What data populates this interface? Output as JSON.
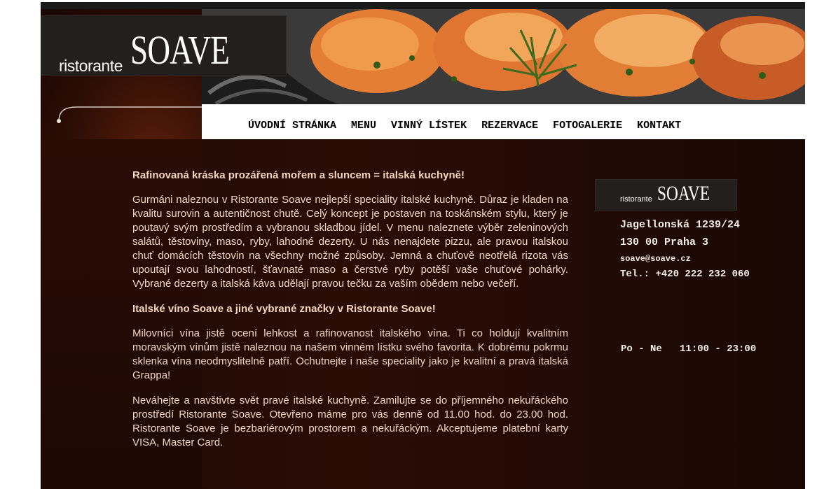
{
  "logo": {
    "small": "ristorante",
    "big": "SOAVE"
  },
  "nav": {
    "items": [
      "ÚVODNÍ STRÁNKA",
      "MENU",
      "VINNÝ LÍSTEK",
      "REZERVACE",
      "FOTOGALERIE",
      "KONTAKT"
    ]
  },
  "content": {
    "heading1": "Rafinovaná kráska prozářená mořem a sluncem = italská kuchyně!",
    "para1": "Gurmáni naleznou v Ristorante Soave nejlepší speciality italské kuchyně. Důraz je kladen na kvalitu surovin a autentičnost chutě. Celý koncept je postaven na toskánském stylu, který je poutavý svým prostředím a vybranou skladbou jídel. V menu naleznete výběr zeleninových salátů, těstoviny, maso, ryby, lahodné dezerty. U nás nenajdete pizzu, ale pravou italskou chuť domácích těstovin na všechny možné způsoby. Jemná a chuťově neotřelá rizota vás upoutají svou lahodností, šťavnaté maso a čerstvé ryby potěší vaše chuťové pohárky. Vybrané dezerty a italská káva udělají pravou tečku za vaším obědem nebo večeří.",
    "heading2": "Italské víno Soave a jiné vybrané značky v Ristorante Soave!",
    "para2": "Milovníci vína jistě ocení lehkost a rafinovanost italského vína. Ti co holdují kvalitním moravským vínům jistě naleznou na našem vinném lístku svého favorita. K dobrému pokrmu sklenka vína neodmyslitelně patří. Ochutnejte i naše speciality jako je kvalitní a pravá italská Grappa!",
    "para3": "Neváhejte a navštivte svět pravé italské kuchyně. Zamilujte se do příjemného nekuřáckého prostředí Ristorante Soave. Otevřeno máme pro vás denně od 11.00 hod. do 23.00 hod. Ristorante Soave je bezbariérovým prostorem a nekuřáckým. Akceptujeme platební karty VISA, Master Card."
  },
  "sidebar": {
    "logo_small": "ristorante",
    "logo_big": "SOAVE",
    "street": "Jagellonská 1239/24",
    "city": "130 00 Praha 3",
    "email": "soave@soave.cz",
    "phone": "Tel.: +420 222 232 060",
    "hours": "Po - Ne   11:00 - 23:00"
  },
  "colors": {
    "background": "#2a0c05",
    "text": "#f1d6c4",
    "nav_bg": "#ffffff",
    "logo_bg": "#231f1d"
  }
}
